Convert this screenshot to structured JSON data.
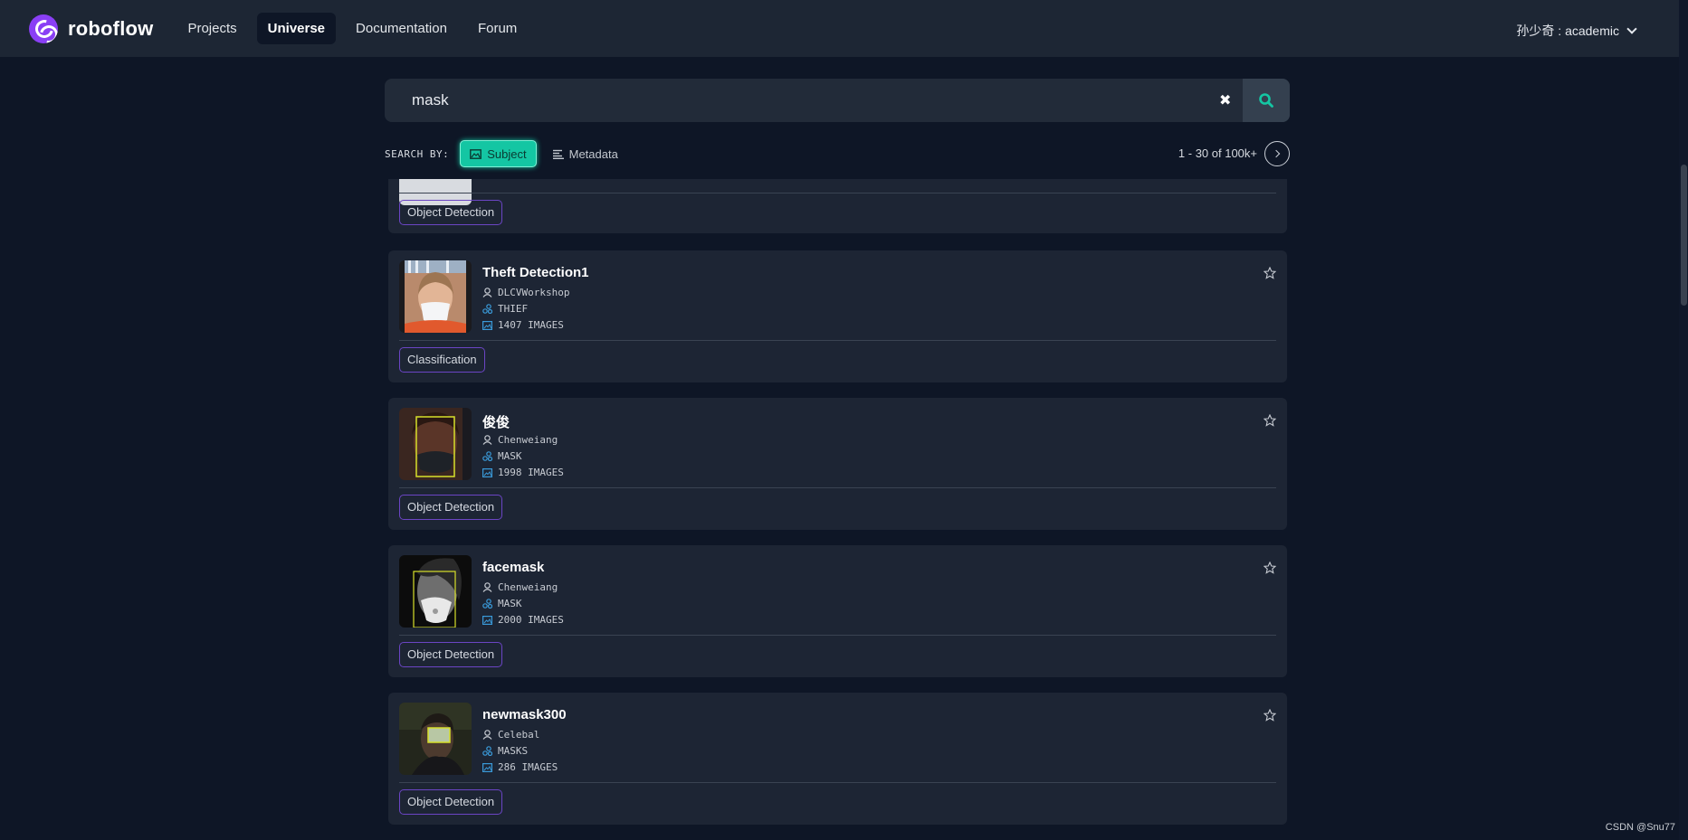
{
  "nav": {
    "brand": "roboflow",
    "items": [
      {
        "label": "Projects",
        "active": false
      },
      {
        "label": "Universe",
        "active": true
      },
      {
        "label": "Documentation",
        "active": false
      },
      {
        "label": "Forum",
        "active": false
      }
    ],
    "user": "孙少奇 : academic"
  },
  "search": {
    "value": "mask",
    "by_label": "SEARCH BY:",
    "options": [
      {
        "label": "Subject",
        "active": true
      },
      {
        "label": "Metadata",
        "active": false
      }
    ],
    "result_count": "1 - 30 of 100k+"
  },
  "results": [
    {
      "title": "",
      "owner": "",
      "classes": "",
      "images": "",
      "type": "Object Detection",
      "partial": true
    },
    {
      "title": "Theft Detection1",
      "owner": "DLCVWorkshop",
      "classes": "THIEF",
      "images": "1407 IMAGES",
      "type": "Classification"
    },
    {
      "title": "俊俊",
      "owner": "Chenweiang",
      "classes": "MASK",
      "images": "1998 IMAGES",
      "type": "Object Detection"
    },
    {
      "title": "facemask",
      "owner": "Chenweiang",
      "classes": "MASK",
      "images": "2000 IMAGES",
      "type": "Object Detection"
    },
    {
      "title": "newmask300",
      "owner": "Celebal",
      "classes": "MASKS",
      "images": "286 IMAGES",
      "type": "Object Detection"
    }
  ],
  "watermark": "CSDN @Snu77",
  "colors": {
    "accent": "#14c6a3",
    "tag_border": "#6b45c4",
    "brand": "#8a3ff5"
  }
}
